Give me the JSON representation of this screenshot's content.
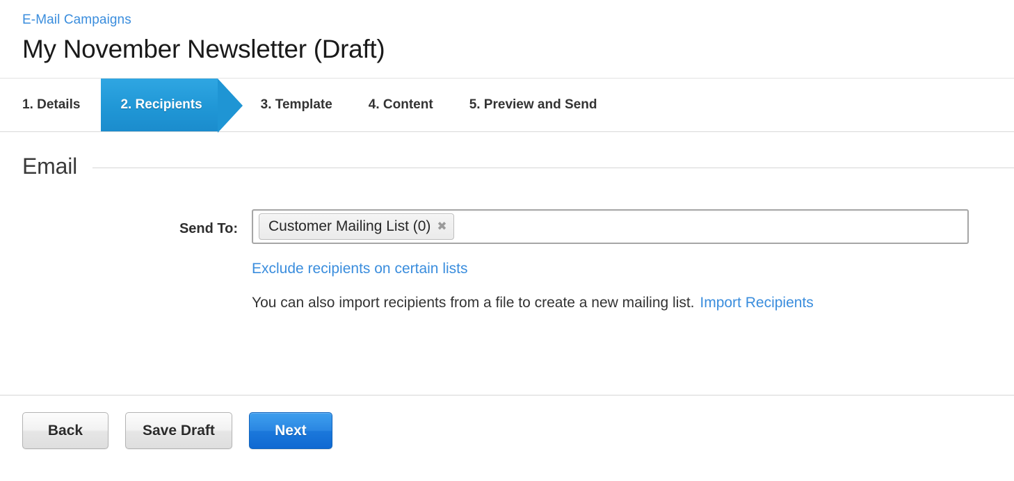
{
  "header": {
    "breadcrumb": "E-Mail Campaigns",
    "title": "My November Newsletter (Draft)"
  },
  "wizard": {
    "steps": [
      {
        "label": "1. Details",
        "active": false
      },
      {
        "label": "2. Recipients",
        "active": true
      },
      {
        "label": "3. Template",
        "active": false
      },
      {
        "label": "4. Content",
        "active": false
      },
      {
        "label": "5. Preview and Send",
        "active": false
      }
    ]
  },
  "section": {
    "title": "Email"
  },
  "form": {
    "send_to": {
      "label": "Send To:",
      "placeholder": "",
      "value": "",
      "tokens": [
        {
          "label": "Customer Mailing List (0)",
          "remove_icon": "close-icon"
        }
      ]
    },
    "exclude_link": "Exclude recipients on certain lists",
    "import_text": "You can also import recipients from a file to create a new mailing list.",
    "import_link": "Import Recipients"
  },
  "footer": {
    "back_label": "Back",
    "save_draft_label": "Save Draft",
    "next_label": "Next"
  },
  "colors": {
    "accent_blue": "#2097d6",
    "link_blue": "#3a8ddd",
    "primary_button_blue": "#1b78db",
    "divider_gray": "#d6d6d6",
    "token_remove_gray": "#9a9a9a"
  }
}
